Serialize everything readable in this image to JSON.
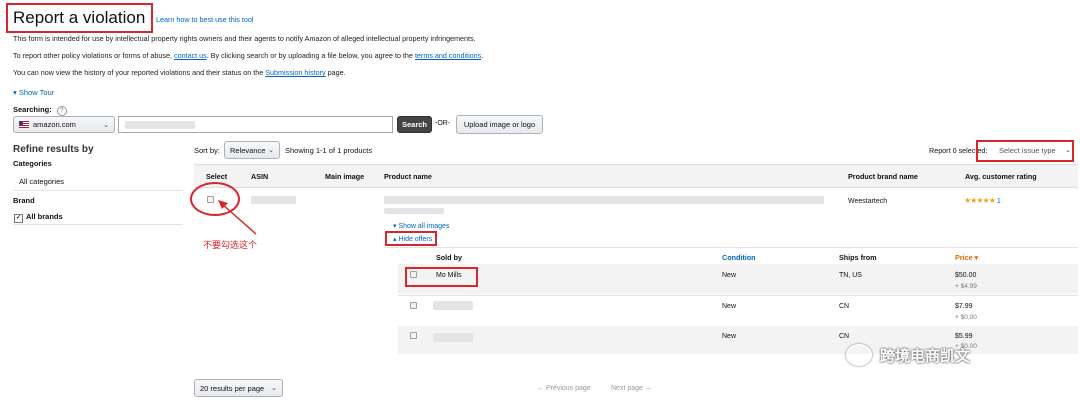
{
  "header": {
    "title": "Report a violation",
    "help_link": "Learn how to best use this tool"
  },
  "intro": {
    "line1": "This form is intended for use by intellectual property rights owners and their agents to notify Amazon of alleged intellectual property infringements.",
    "line2_a": "To report other policy violations or forms of abuse,",
    "line2_link1": "contact us",
    "line2_b": ". By clicking search or by uploading a file below, you agree to the",
    "line2_link2": "terms and conditions",
    "line2_c": ".",
    "line3_a": "You can now view the history of your reported violations and their status on the",
    "line3_link": "Submission history",
    "line3_b": "page."
  },
  "tour": {
    "label": "Show Tour"
  },
  "search": {
    "label": "Searching:",
    "help": "?",
    "marketplace": "amazon.com",
    "query": "",
    "button": "Search",
    "or": "-OR-",
    "upload": "Upload image or logo"
  },
  "filters": {
    "title": "Refine results by",
    "categories_label": "Categories",
    "categories_value": "All categories",
    "brand_label": "Brand",
    "brand_value": "All brands"
  },
  "results_bar": {
    "sort_label": "Sort by:",
    "sort_value": "Relevance",
    "showing": "Showing 1-1 of 1 products",
    "report_label": "Report 0 selected:",
    "issue_type_placeholder": "Select issue type"
  },
  "table": {
    "headers": [
      "Select",
      "ASIN",
      "Main image",
      "Product name",
      "Product brand name",
      "Avg. customer rating"
    ],
    "product": {
      "brand": "Weestartech",
      "rating_stars": "★★★★★",
      "rating_count": "1",
      "show_images": "Show all images",
      "hide_offers": "Hide offers"
    }
  },
  "offers": {
    "headers": {
      "sold_by": "Sold by",
      "condition": "Condition",
      "ships_from": "Ships from",
      "price": "Price"
    },
    "rows": [
      {
        "seller": "Mo Mills",
        "condition": "New",
        "ships_from": "TN, US",
        "price": "$50.00",
        "shipping": "+ $4.99"
      },
      {
        "seller": "",
        "condition": "New",
        "ships_from": "CN",
        "price": "$7.99",
        "shipping": "+ $0.00"
      },
      {
        "seller": "",
        "condition": "New",
        "ships_from": "CN",
        "price": "$5.99",
        "shipping": "+ $0.00"
      }
    ]
  },
  "annotation": {
    "note": "不要勾选这个"
  },
  "pagination": {
    "per_page": "20 results per page",
    "prev": "← Previous page",
    "next": "Next page →"
  },
  "watermark": {
    "text": "跨境电商凯文"
  },
  "colors": {
    "accent": "#0066c0",
    "annotation": "#d9262c",
    "stars": "#f0a020"
  }
}
